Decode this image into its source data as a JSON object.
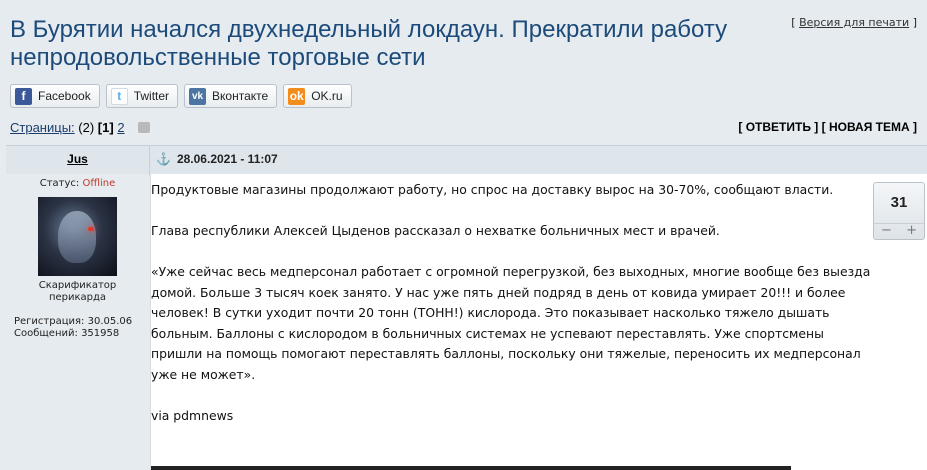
{
  "print_link": {
    "before": "[ ",
    "label": "Версия для печати",
    "after": " ]"
  },
  "title": "В Бурятии начался двухнедельный локдаун. Прекратили работу непродовольственные торговые сети",
  "share": [
    {
      "label": "Facebook",
      "icon": "f"
    },
    {
      "label": "Twitter",
      "icon": "t"
    },
    {
      "label": "Вконтакте",
      "icon": "vk"
    },
    {
      "label": "OK.ru",
      "icon": "ok"
    }
  ],
  "pagination": {
    "label": "Страницы:",
    "count": "(2)",
    "current": "1",
    "next": "2"
  },
  "actions": {
    "open": "[ ",
    "reply": "ОТВЕТИТЬ",
    "sep": " ] [ ",
    "new_topic": "НОВАЯ ТЕМА",
    "close": " ]"
  },
  "post": {
    "author": "Jus",
    "date": "28.06.2021 - 11:07",
    "status_label": "Статус:",
    "status_value": "Offline",
    "rank_line1": "Скарификатор",
    "rank_line2": "перикарда",
    "reg_label": "Регистрация:",
    "reg_value": "30.05.06",
    "msgs_label": "Сообщений:",
    "msgs_value": "351958",
    "rating": "31",
    "rating_minus": "−",
    "rating_plus": "+",
    "paragraphs": [
      "Продуктовые магазины продолжают работу, но спрос на доставку вырос на 30-70%, сообщают власти.",
      "Глава республики Алексей Цыденов рассказал о нехватке больничных мест и врачей.",
      "«Уже сейчас весь медперсонал работает с огромной перегрузкой, без выходных, многие вообще без выезда домой. Больше 3 тысяч коек занято. У нас уже пять дней подряд в день от ковида умирает 20!!! и более человек! В сутки уходит почти 20 тонн (ТОНН!) кислорода. Это показывает насколько тяжело дышать больным. Баллоны с кислородом в больничных системах не успевают переставлять. Уже спортсмены пришли на помощь помогают переставлять баллоны, поскольку они тяжелые, переносить их медперсонал уже не может».",
      "via pdmnews"
    ]
  },
  "colors": {
    "title": "#1c4b7b",
    "offline": "#c0392b",
    "facebook": "#3b5998",
    "vk": "#4c75a3",
    "ok": "#f28d1b"
  }
}
